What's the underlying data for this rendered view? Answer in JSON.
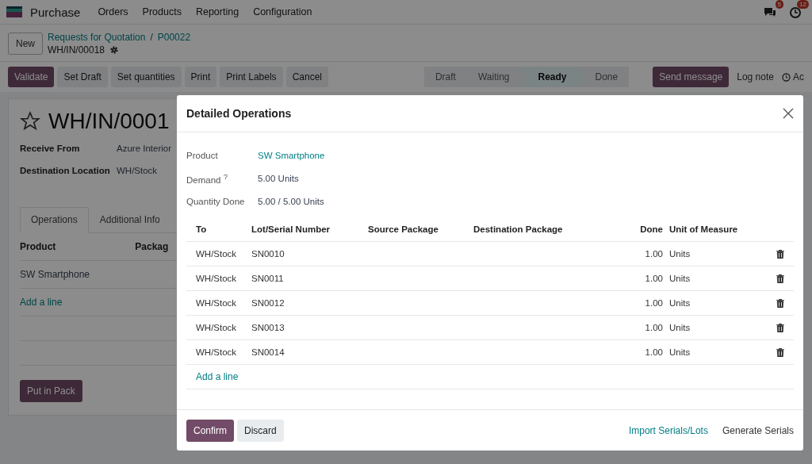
{
  "navbar": {
    "app_name": "Purchase",
    "menu": [
      "Orders",
      "Products",
      "Reporting",
      "Configuration"
    ],
    "messages_badge": "5",
    "activities_badge": "12"
  },
  "control_panel": {
    "new_button": "New",
    "breadcrumbs": [
      "Requests for Quotation",
      "P00022"
    ],
    "separator": "/",
    "current": "WH/IN/00018"
  },
  "actions": [
    {
      "label": "Validate",
      "primary": true
    },
    {
      "label": "Set Draft",
      "primary": false
    },
    {
      "label": "Set quantities",
      "primary": false
    },
    {
      "label": "Print",
      "primary": false
    },
    {
      "label": "Print Labels",
      "primary": false
    },
    {
      "label": "Cancel",
      "primary": false
    }
  ],
  "status_bar": [
    {
      "label": "Draft",
      "selected": false
    },
    {
      "label": "Waiting",
      "selected": false
    },
    {
      "label": "Ready",
      "selected": true
    },
    {
      "label": "Done",
      "selected": false
    }
  ],
  "chatter": {
    "send_message": "Send message",
    "log_note": "Log note",
    "activities": "Ac"
  },
  "form": {
    "title": "WH/IN/0001",
    "fields": [
      {
        "label": "Receive From",
        "value": "Azure Interior"
      },
      {
        "label": "Destination Location",
        "value": "WH/Stock"
      }
    ],
    "tabs": [
      {
        "label": "Operations",
        "selected": true
      },
      {
        "label": "Additional Info",
        "selected": false
      }
    ],
    "columns": [
      "Product",
      "Packag"
    ],
    "rows": [
      "SW Smartphone"
    ],
    "add_line": "Add a line",
    "put_in_pack": "Put in Pack"
  },
  "dialog": {
    "title": "Detailed Operations",
    "fields": [
      {
        "label": "Product",
        "value": "SW Smartphone",
        "kind": "link"
      },
      {
        "label": "Demand $^{?}$",
        "value": "5.00 Units",
        "kind": "text"
      },
      {
        "label": "Quantity Done",
        "value": "5.00 / 5.00 Units",
        "kind": "text"
      }
    ],
    "columns": [
      "To",
      "Lot/Serial Number",
      "Source Package",
      "Destination Package",
      "Done",
      "Unit of Measure"
    ],
    "rows": [
      {
        "to": "WH/Stock",
        "lot": "SN0010",
        "done": "1.00",
        "uom": "Units"
      },
      {
        "to": "WH/Stock",
        "lot": "SN0011",
        "done": "1.00",
        "uom": "Units"
      },
      {
        "to": "WH/Stock",
        "lot": "SN0012",
        "done": "1.00",
        "uom": "Units"
      },
      {
        "to": "WH/Stock",
        "lot": "SN0013",
        "done": "1.00",
        "uom": "Units"
      },
      {
        "to": "WH/Stock",
        "lot": "SN0014",
        "done": "1.00",
        "uom": "Units"
      }
    ],
    "add_line": "Add a line",
    "confirm": "Confirm",
    "discard": "Discard",
    "import": "Import Serials/Lots",
    "generate": "Generate Serials"
  }
}
